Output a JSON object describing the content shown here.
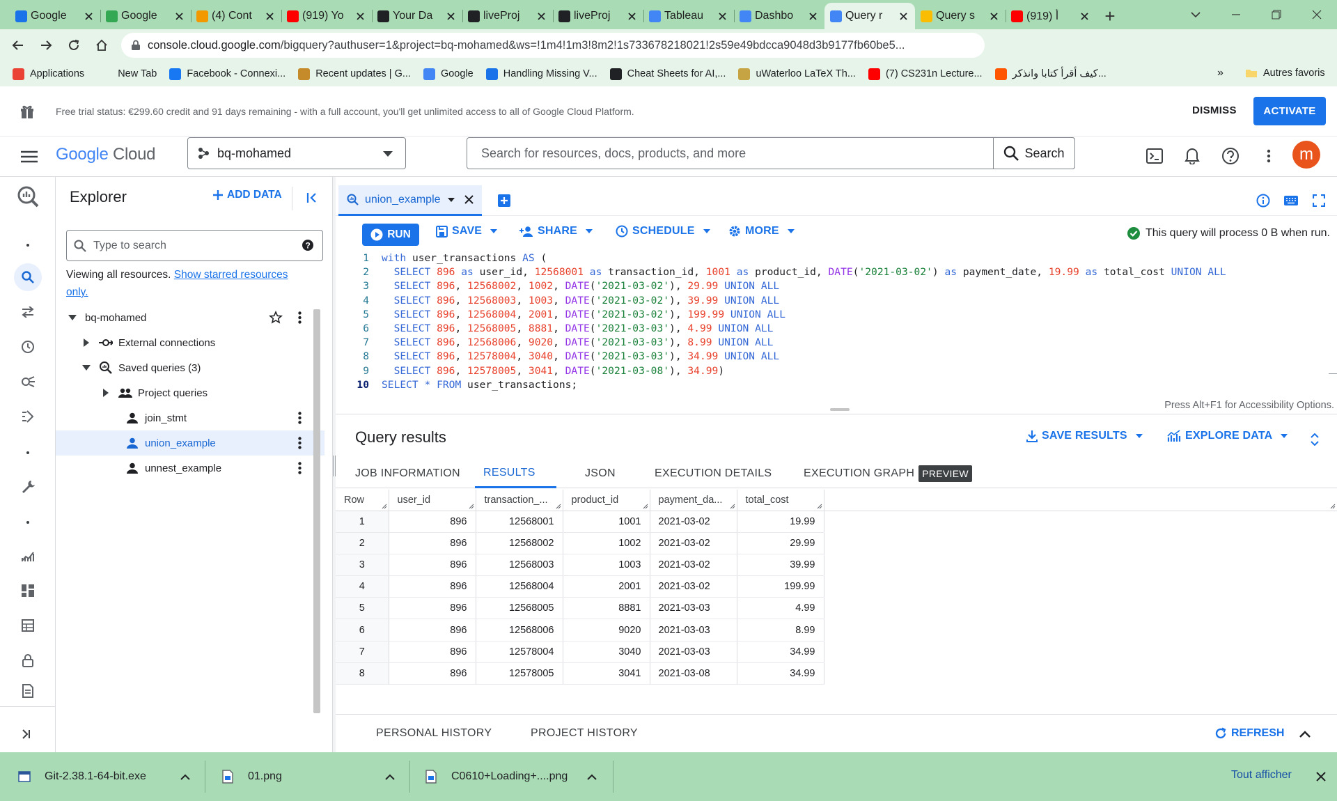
{
  "browser": {
    "tabs": [
      {
        "label": "Google",
        "color": "#1a73e8",
        "active": false
      },
      {
        "label": "Google",
        "color": "#34a853",
        "active": false
      },
      {
        "label": "(4) Cont",
        "color": "#f29900",
        "active": false
      },
      {
        "label": "(919) Yo",
        "color": "#ff0000",
        "active": false
      },
      {
        "label": "Your Da",
        "color": "#202124",
        "active": false
      },
      {
        "label": "liveProj",
        "color": "#202124",
        "active": false
      },
      {
        "label": "liveProj",
        "color": "#202124",
        "active": false
      },
      {
        "label": "Tableau",
        "color": "#4285f4",
        "active": false
      },
      {
        "label": "Dashbo",
        "color": "#4285f4",
        "active": false
      },
      {
        "label": "Query r",
        "color": "#4285f4",
        "active": true
      },
      {
        "label": "Query s",
        "color": "#fbbc04",
        "active": false
      },
      {
        "label": "(919) أ",
        "color": "#ff0000",
        "active": false
      }
    ],
    "url_host": "console.cloud.google.com",
    "url_path": "/bigquery?authuser=1&project=bq-mohamed&ws=!1m4!1m3!8m2!1s733678218021!2s59e49bdcca9048d3b9177fb60be5...",
    "bookmarks": [
      {
        "label": "Applications",
        "icon": "apps-icon",
        "color": "#ea4335"
      },
      {
        "label": "New Tab",
        "icon": "",
        "color": ""
      },
      {
        "label": "Facebook - Connexi...",
        "icon": "facebook-icon",
        "color": "#1877f2"
      },
      {
        "label": "Recent updates | G...",
        "icon": "grammarly-icon",
        "color": "#c58a2a"
      },
      {
        "label": "Google",
        "icon": "google-icon",
        "color": "#4285f4"
      },
      {
        "label": "Handling Missing V...",
        "icon": "k-icon",
        "color": "#1a73e8"
      },
      {
        "label": "Cheat Sheets for AI,...",
        "icon": "ai-icon",
        "color": "#202124"
      },
      {
        "label": "uWaterloo LaTeX Th...",
        "icon": "crest-icon",
        "color": "#c7a443"
      },
      {
        "label": "(7) CS231n Lecture...",
        "icon": "youtube-icon",
        "color": "#ff0000"
      },
      {
        "label": "كيف أقرأ كتابا وانذكر...",
        "icon": "soundcloud-icon",
        "color": "#ff5500"
      }
    ],
    "more_bookmarks": "»",
    "other_bookmarks": "Autres favoris"
  },
  "banner": {
    "text": "Free trial status: €299.60 credit and 91 days remaining - with a full account, you'll get unlimited access to all of Google Cloud Platform.",
    "dismiss": "DISMISS",
    "activate": "ACTIVATE"
  },
  "header": {
    "logo_google": "Google",
    "logo_cloud": "Cloud",
    "project": "bq-mohamed",
    "search_placeholder": "Search for resources, docs, products, and more",
    "search_button": "Search",
    "avatar_letter": "m",
    "avatar_color": "#e8541c"
  },
  "explorer": {
    "title": "Explorer",
    "add_data": "ADD DATA",
    "search_placeholder": "Type to search",
    "viewing_text": "Viewing all resources.",
    "starred_link": "Show starred resources only.",
    "tree": [
      {
        "label": "bq-mohamed"
      },
      {
        "label": "External connections"
      },
      {
        "label": "Saved queries (3)"
      },
      {
        "label": "Project queries"
      },
      {
        "label": "join_stmt"
      },
      {
        "label": "union_example"
      },
      {
        "label": "unnest_example"
      }
    ]
  },
  "editor": {
    "tab_label": "union_example",
    "run": "RUN",
    "save": "SAVE",
    "share": "SHARE",
    "schedule": "SCHEDULE",
    "more": "MORE",
    "process_msg": "This query will process 0 B when run.",
    "a11y_hint": "Press Alt+F1 for Accessibility Options.",
    "code_lines": [
      "with user_transactions AS (",
      "  SELECT 896 as user_id, 12568001 as transaction_id, 1001 as product_id, DATE('2021-03-02') as payment_date, 19.99 as total_cost UNION ALL",
      "  SELECT 896, 12568002, 1002, DATE('2021-03-02'), 29.99 UNION ALL",
      "  SELECT 896, 12568003, 1003, DATE('2021-03-02'), 39.99 UNION ALL",
      "  SELECT 896, 12568004, 2001, DATE('2021-03-02'), 199.99 UNION ALL",
      "  SELECT 896, 12568005, 8881, DATE('2021-03-03'), 4.99 UNION ALL",
      "  SELECT 896, 12568006, 9020, DATE('2021-03-03'), 8.99 UNION ALL",
      "  SELECT 896, 12578004, 3040, DATE('2021-03-03'), 34.99 UNION ALL",
      "  SELECT 896, 12578005, 3041, DATE('2021-03-08'), 34.99)",
      "SELECT * FROM user_transactions;"
    ]
  },
  "results": {
    "title": "Query results",
    "save_results": "SAVE RESULTS",
    "explore_data": "EXPLORE DATA",
    "tabs": [
      "JOB INFORMATION",
      "RESULTS",
      "JSON",
      "EXECUTION DETAILS",
      "EXECUTION GRAPH"
    ],
    "preview_badge": "PREVIEW",
    "columns": [
      "Row",
      "user_id",
      "transaction_...",
      "product_id",
      "payment_da...",
      "total_cost"
    ],
    "rows": [
      [
        "1",
        "896",
        "12568001",
        "1001",
        "2021-03-02",
        "19.99"
      ],
      [
        "2",
        "896",
        "12568002",
        "1002",
        "2021-03-02",
        "29.99"
      ],
      [
        "3",
        "896",
        "12568003",
        "1003",
        "2021-03-02",
        "39.99"
      ],
      [
        "4",
        "896",
        "12568004",
        "2001",
        "2021-03-02",
        "199.99"
      ],
      [
        "5",
        "896",
        "12568005",
        "8881",
        "2021-03-03",
        "4.99"
      ],
      [
        "6",
        "896",
        "12568006",
        "9020",
        "2021-03-03",
        "8.99"
      ],
      [
        "7",
        "896",
        "12578004",
        "3040",
        "2021-03-03",
        "34.99"
      ],
      [
        "8",
        "896",
        "12578005",
        "3041",
        "2021-03-08",
        "34.99"
      ]
    ],
    "personal_history": "PERSONAL HISTORY",
    "project_history": "PROJECT HISTORY",
    "refresh": "REFRESH"
  },
  "downloads": {
    "items": [
      "Git-2.38.1-64-bit.exe",
      "01.png",
      "C0610+Loading+....png"
    ],
    "show_all": "Tout afficher"
  }
}
